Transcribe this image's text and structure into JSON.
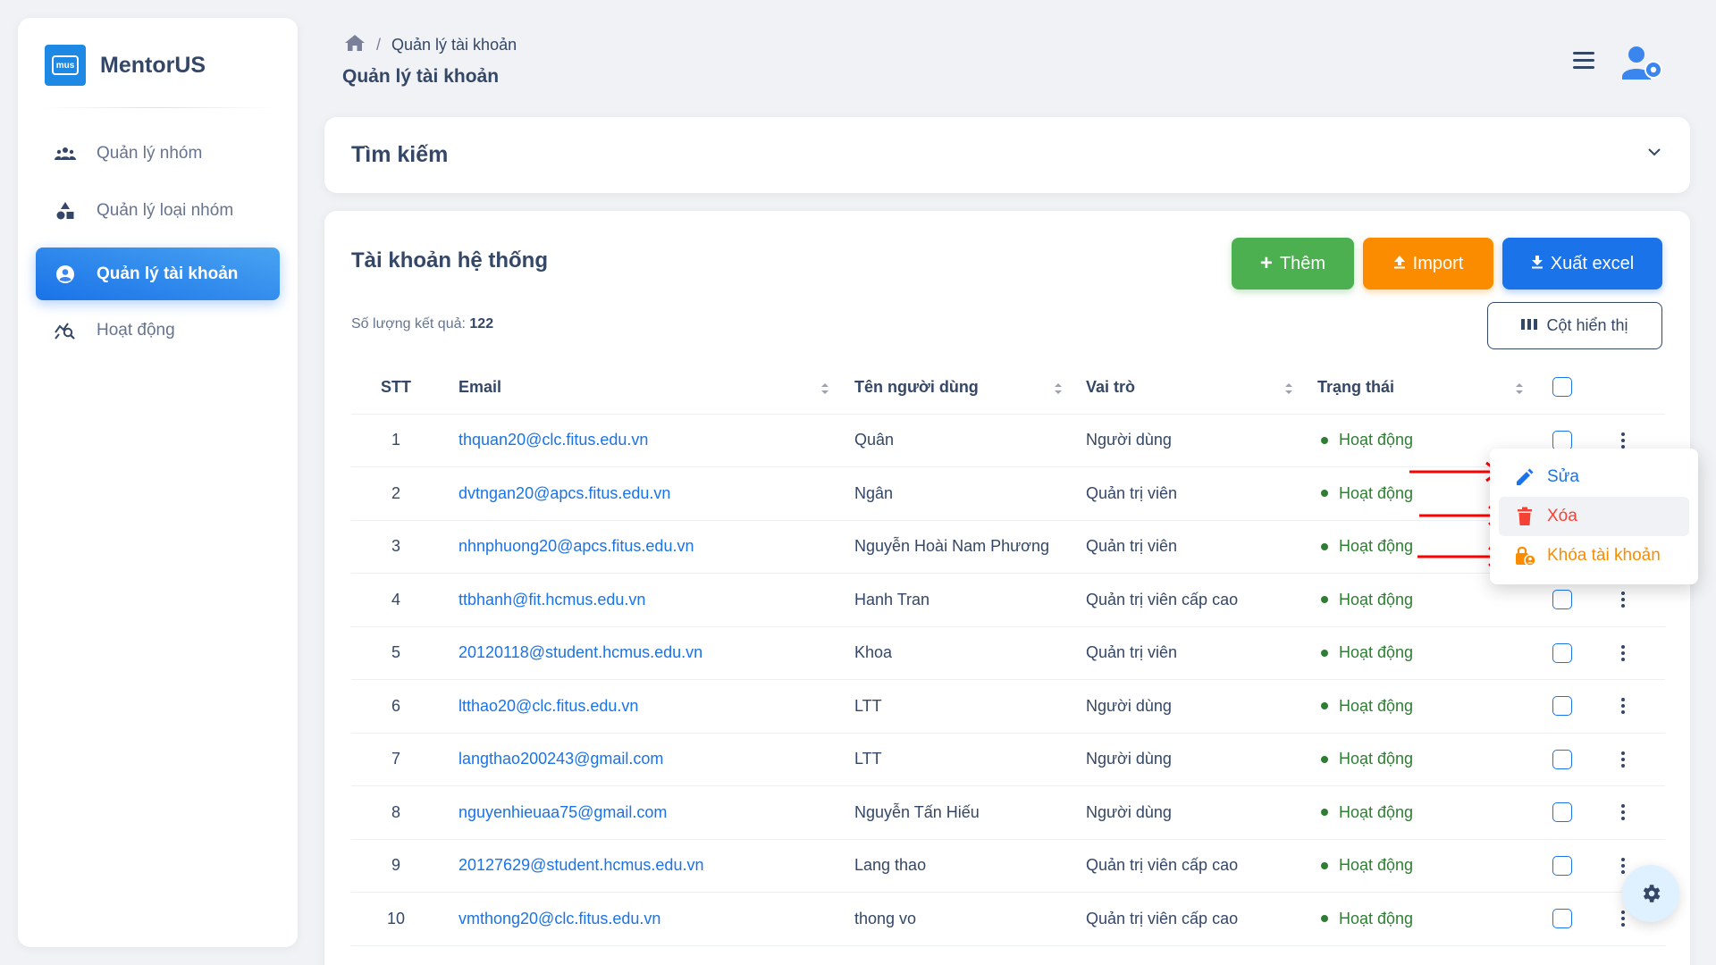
{
  "app": {
    "name": "MentorUS",
    "logo_text": "mus"
  },
  "sidebar": {
    "items": [
      {
        "label": "Quản lý nhóm",
        "icon": "group-icon",
        "active": false
      },
      {
        "label": "Quản lý loại nhóm",
        "icon": "category-icon",
        "active": false
      },
      {
        "label": "Quản lý tài khoản",
        "icon": "account-circle-icon",
        "active": true
      },
      {
        "label": "Hoạt động",
        "icon": "query-stats-icon",
        "active": false
      }
    ]
  },
  "header": {
    "breadcrumb": [
      "Quản lý tài khoản"
    ],
    "title": "Quản lý tài khoản"
  },
  "search": {
    "title": "Tìm kiếm"
  },
  "main": {
    "title": "Tài khoản hệ thống",
    "buttons": {
      "add": "Thêm",
      "import": "Import",
      "export": "Xuất excel",
      "columns": "Cột hiển thị"
    },
    "result_label": "Số lượng kết quả:",
    "result_count": "122"
  },
  "table": {
    "columns": [
      "STT",
      "Email",
      "Tên người dùng",
      "Vai trò",
      "Trạng thái"
    ],
    "rows": [
      {
        "stt": "1",
        "email": "thquan20@clc.fitus.edu.vn",
        "name": "Quân",
        "role": "Người dùng",
        "status": "Hoạt động"
      },
      {
        "stt": "2",
        "email": "dvtngan20@apcs.fitus.edu.vn",
        "name": "Ngân",
        "role": "Quản trị viên",
        "status": "Hoạt động"
      },
      {
        "stt": "3",
        "email": "nhnphuong20@apcs.fitus.edu.vn",
        "name": "Nguyễn Hoài Nam Phương",
        "role": "Quản trị viên",
        "status": "Hoạt động"
      },
      {
        "stt": "4",
        "email": "ttbhanh@fit.hcmus.edu.vn",
        "name": "Hanh Tran",
        "role": "Quản trị viên cấp cao",
        "status": "Hoạt động"
      },
      {
        "stt": "5",
        "email": "20120118@student.hcmus.edu.vn",
        "name": "Khoa",
        "role": "Quản trị viên",
        "status": "Hoạt động"
      },
      {
        "stt": "6",
        "email": "ltthao20@clc.fitus.edu.vn",
        "name": "LTT",
        "role": "Người dùng",
        "status": "Hoạt động"
      },
      {
        "stt": "7",
        "email": "langthao200243@gmail.com",
        "name": "LTT",
        "role": "Người dùng",
        "status": "Hoạt động"
      },
      {
        "stt": "8",
        "email": "nguyenhieuaa75@gmail.com",
        "name": "Nguyễn Tấn Hiếu",
        "role": "Người dùng",
        "status": "Hoạt động"
      },
      {
        "stt": "9",
        "email": "20127629@student.hcmus.edu.vn",
        "name": "Lang thao",
        "role": "Quản trị viên cấp cao",
        "status": "Hoạt động"
      },
      {
        "stt": "10",
        "email": "vmthong20@clc.fitus.edu.vn",
        "name": "thong vo",
        "role": "Quản trị viên cấp cao",
        "status": "Hoạt động"
      }
    ]
  },
  "context_menu": {
    "items": [
      {
        "label": "Sửa",
        "icon": "edit-icon",
        "color": "#1a73e8"
      },
      {
        "label": "Xóa",
        "icon": "trash-icon",
        "color": "#f44335"
      },
      {
        "label": "Khóa tài khoản",
        "icon": "lock-person-icon",
        "color": "#fb8c00"
      }
    ]
  },
  "colors": {
    "primary": "#1a73e8",
    "success": "#4caf50",
    "warning": "#fb8c00",
    "danger": "#f44335",
    "status_active": "#2e7d32",
    "annotation_arrow": "#ff0000"
  }
}
